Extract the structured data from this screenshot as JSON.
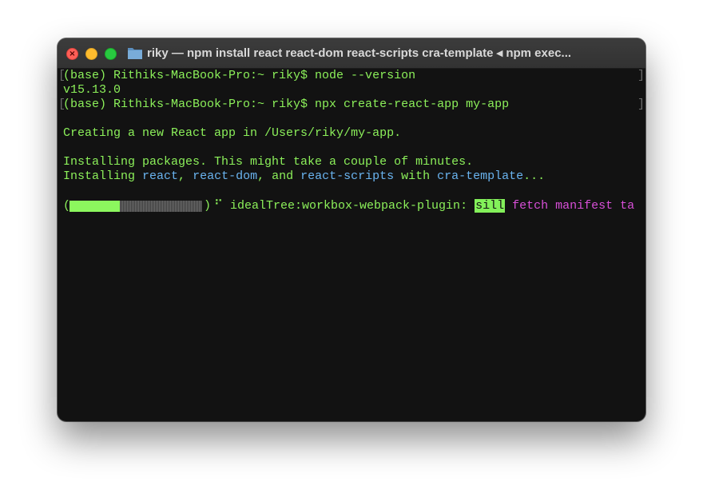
{
  "window": {
    "title": "riky — npm install react react-dom react-scripts cra-template ◂ npm exec...",
    "folder_icon": "folder-icon",
    "traffic_lights": [
      "close",
      "minimize",
      "zoom"
    ]
  },
  "terminal": {
    "prompt1": "(base) Rithiks-MacBook-Pro:~ riky$ node --version",
    "output1": "v15.13.0",
    "prompt2": "(base) Rithiks-MacBook-Pro:~ riky$ npx create-react-app my-app",
    "creating_prefix": "Creating a new React app in ",
    "creating_path": "/Users/riky/my-app",
    "creating_suffix": ".",
    "installing_line": "Installing packages. This might take a couple of minutes.",
    "installing2": {
      "prefix": "Installing ",
      "pkg1": "react",
      "sep1": ", ",
      "pkg2": "react-dom",
      "sep2": ", and ",
      "pkg3": "react-scripts",
      "mid": " with ",
      "pkg4": "cra-template",
      "suffix": "..."
    },
    "progress": {
      "fraction": 0.38,
      "spinner": "⠋",
      "stage": "idealTree:workbox-webpack-plugin: ",
      "level": "sill",
      "message": " fetch manifest ta"
    }
  },
  "colors": {
    "green": "#8cf05a",
    "blue": "#6ab4f0",
    "magenta": "#d84fd8",
    "background": "#121212"
  }
}
